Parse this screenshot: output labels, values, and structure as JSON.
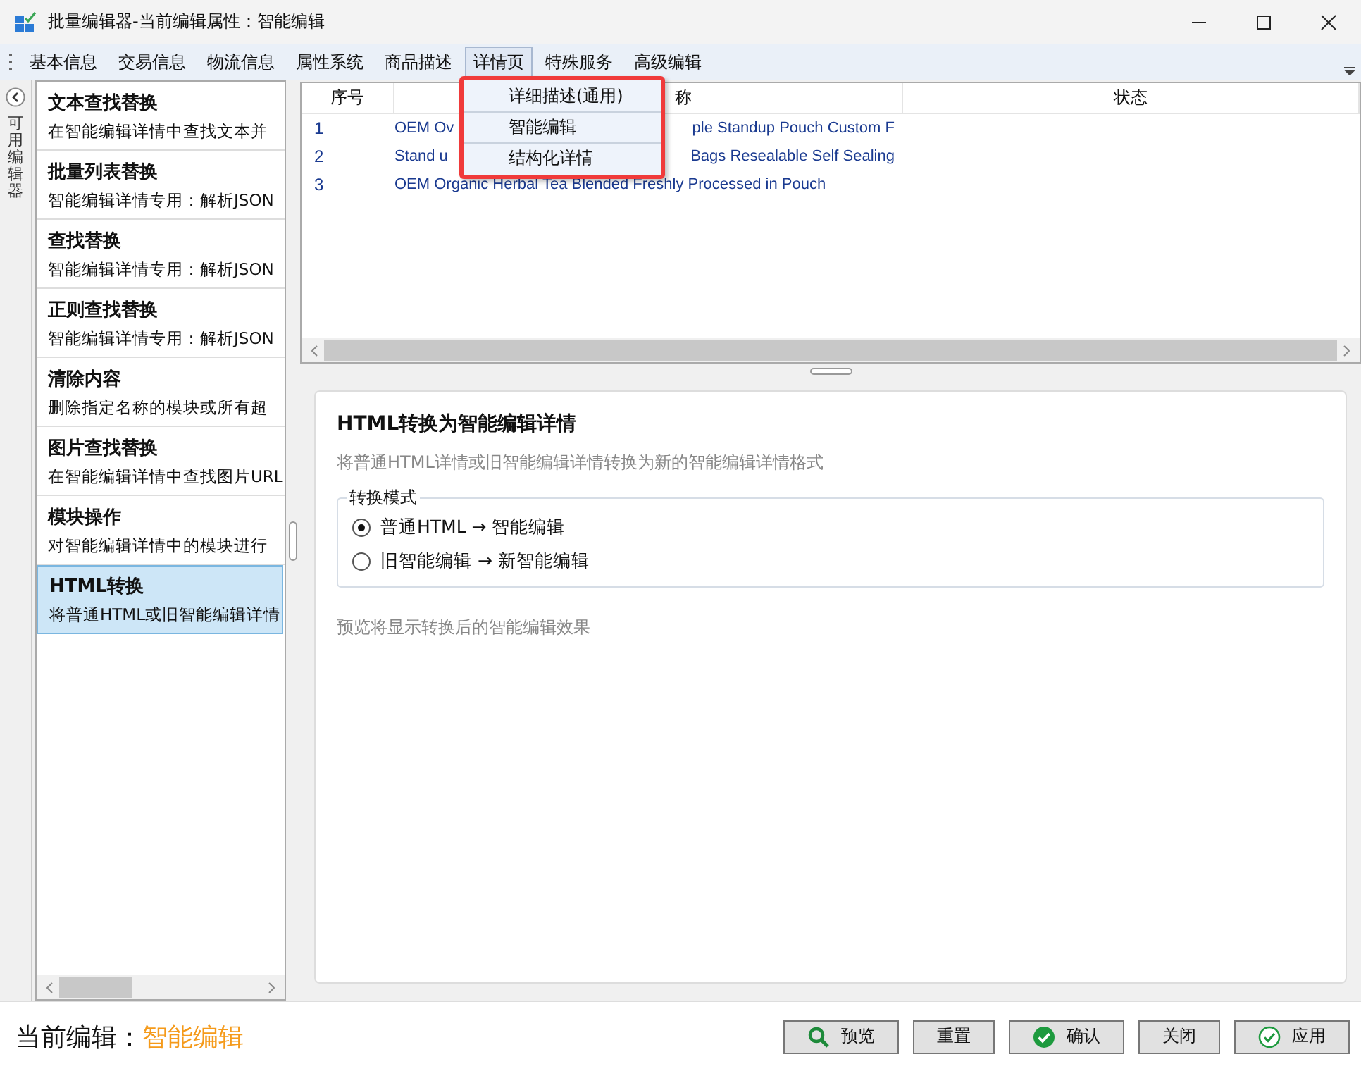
{
  "window": {
    "title": "批量编辑器-当前编辑属性：智能编辑"
  },
  "menu_bar": {
    "items": [
      {
        "label": "基本信息",
        "selected": false
      },
      {
        "label": "交易信息",
        "selected": false
      },
      {
        "label": "物流信息",
        "selected": false
      },
      {
        "label": "属性系统",
        "selected": false
      },
      {
        "label": "商品描述",
        "selected": false
      },
      {
        "label": "详情页",
        "selected": true
      },
      {
        "label": "特殊服务",
        "selected": false
      },
      {
        "label": "高级编辑",
        "selected": false
      }
    ]
  },
  "dropdown_menu": {
    "items": [
      {
        "label": "详细描述(通用)"
      },
      {
        "label": "智能编辑"
      },
      {
        "label": "结构化详情"
      }
    ]
  },
  "sidebar_toggle": {
    "label": "可用编辑器"
  },
  "editors": [
    {
      "title": "文本查找替换",
      "description": "在智能编辑详情中查找文本并",
      "selected": false
    },
    {
      "title": "批量列表替换",
      "description": "智能编辑详情专用：解析JSON",
      "selected": false
    },
    {
      "title": "查找替换",
      "description": "智能编辑详情专用：解析JSON",
      "selected": false
    },
    {
      "title": "正则查找替换",
      "description": "智能编辑详情专用：解析JSON",
      "selected": false
    },
    {
      "title": "清除内容",
      "description": "删除指定名称的模块或所有超",
      "selected": false
    },
    {
      "title": "图片查找替换",
      "description": "在智能编辑详情中查找图片URL",
      "selected": false
    },
    {
      "title": "模块操作",
      "description": "对智能编辑详情中的模块进行",
      "selected": false
    },
    {
      "title": "HTML转换",
      "description": "将普通HTML或旧智能编辑详情",
      "selected": true
    }
  ],
  "table": {
    "columns": [
      "序号",
      "称",
      "状态"
    ],
    "rows": [
      {
        "index": "1",
        "name_parts": [
          "OEM Ov",
          "ple Standup Pouch Custom F"
        ]
      },
      {
        "index": "2",
        "name_parts": [
          "Stand u",
          "Bags Resealable Self Sealing"
        ]
      },
      {
        "index": "3",
        "name_parts": [
          "OEM Organic Herbal Tea Blended Freshly Processed in Pouch"
        ]
      }
    ]
  },
  "panel": {
    "title": "HTML转换为智能编辑详情",
    "subtitle": "将普通HTML详情或旧智能编辑详情转换为新的智能编辑详情格式",
    "group": {
      "label": "转换模式",
      "options": [
        {
          "label": "普通HTML → 智能编辑",
          "selected": true
        },
        {
          "label": "旧智能编辑 → 新智能编辑",
          "selected": false
        }
      ]
    },
    "preview_hint": "预览将显示转换后的智能编辑效果"
  },
  "status": {
    "label": "当前编辑：",
    "value": "智能编辑"
  },
  "buttons": [
    {
      "label": "预览",
      "kind": "search"
    },
    {
      "label": "重置",
      "kind": "plain"
    },
    {
      "label": "确认",
      "kind": "check-filled"
    },
    {
      "label": "关闭",
      "kind": "plain"
    },
    {
      "label": "应用",
      "kind": "check-outline"
    }
  ]
}
